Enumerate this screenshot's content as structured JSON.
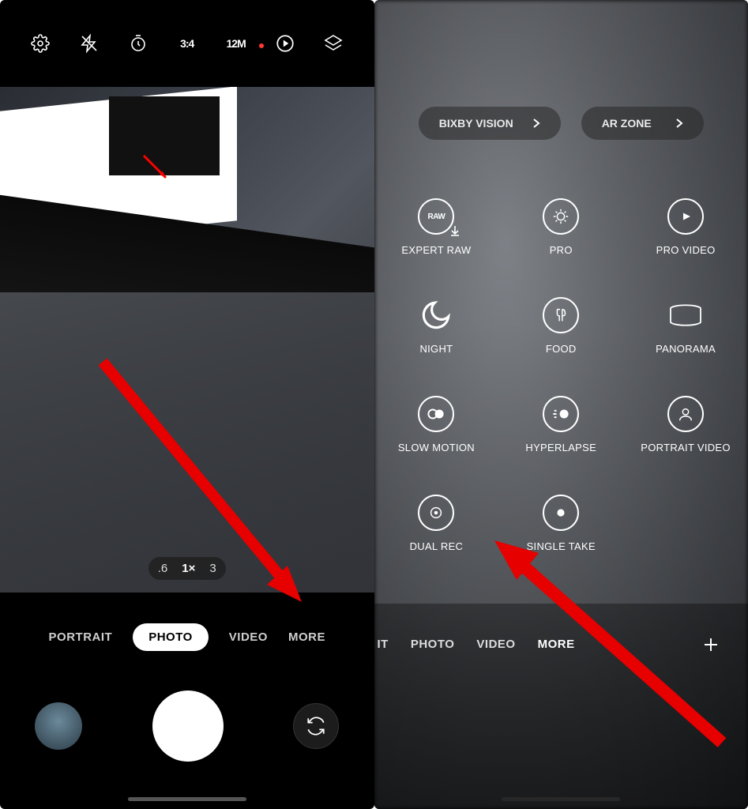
{
  "left": {
    "topbar": {
      "ratio": "3:4",
      "megapixel": "12M"
    },
    "zoom": {
      "wide": ".6",
      "one": "1×",
      "tele": "3"
    },
    "modes": {
      "portrait": "PORTRAIT",
      "photo": "PHOTO",
      "video": "VIDEO",
      "more": "MORE"
    }
  },
  "right": {
    "pills": {
      "bixby": "BIXBY VISION",
      "arzone": "AR ZONE"
    },
    "modes": {
      "expert_raw": "EXPERT RAW",
      "pro": "PRO",
      "pro_video": "PRO VIDEO",
      "night": "NIGHT",
      "food": "FOOD",
      "panorama": "PANORAMA",
      "slow_motion": "SLOW MOTION",
      "hyperlapse": "HYPERLAPSE",
      "portrait_video": "PORTRAIT VIDEO",
      "dual_rec": "DUAL REC",
      "single_take": "SINGLE TAKE"
    },
    "raw_badge": "RAW",
    "tabs": {
      "it": "IT",
      "photo": "PHOTO",
      "video": "VIDEO",
      "more": "MORE"
    }
  }
}
